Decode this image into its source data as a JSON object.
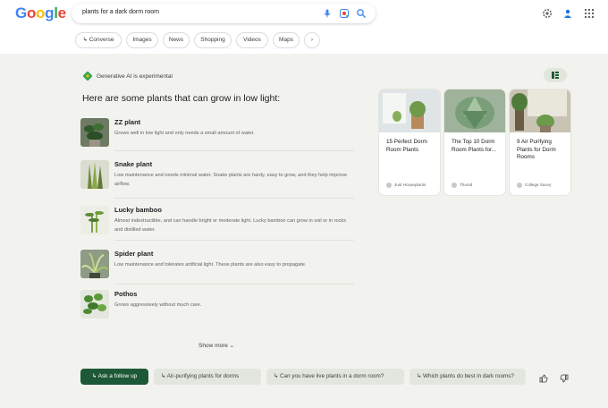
{
  "header": {
    "logo": [
      "G",
      "o",
      "o",
      "g",
      "l",
      "e"
    ],
    "query": "plants for a dark dorm room",
    "icons": [
      "microphone-icon",
      "lens-icon",
      "search-icon",
      "gear-icon",
      "account-icon",
      "apps-grid-icon"
    ]
  },
  "chips": [
    {
      "label": "↳ Converse"
    },
    {
      "label": "Images"
    },
    {
      "label": "News"
    },
    {
      "label": "Shopping"
    },
    {
      "label": "Videos"
    },
    {
      "label": "Maps"
    },
    {
      "label": "›"
    }
  ],
  "ai": {
    "label": "Generative AI is experimental",
    "heading": "Here are some plants that can grow in low light:",
    "items": [
      {
        "title": "ZZ plant",
        "desc": "Grows well in low light and only needs a small amount of water."
      },
      {
        "title": "Snake plant",
        "desc": "Low maintenance and needs minimal water. Snake plants are hardy, easy to grow, and they help improve airflow."
      },
      {
        "title": "Lucky bamboo",
        "desc": "Almost indestructible, and can handle bright or moderate light. Lucky bamboo can grow in soil or in rocks and distilled water."
      },
      {
        "title": "Spider plant",
        "desc": "Low maintenance and tolerates artificial light. These plants are also easy to propagate."
      },
      {
        "title": "Pothos",
        "desc": "Grows aggressively without much care."
      }
    ],
    "show_more": "Show more ⌄",
    "sources": [
      {
        "title": "15 Perfect Dorm Room Plants",
        "source": "Just Houseplants"
      },
      {
        "title": "The Top 10 Dorm Room Plants for...",
        "source": "Thursd"
      },
      {
        "title": "9 Air Purifying Plants for Dorm Rooms",
        "source": "College Savvy"
      }
    ]
  },
  "followup": {
    "button": "↳ Ask a follow up",
    "suggestions": [
      "↳ Air-purifying plants for dorms",
      "↳ Can you have live plants in a dorm room?",
      "↳ Which plants do best in dark rooms?"
    ]
  },
  "colors": {
    "panel_bg": "#f2f3ee",
    "accent_green": "#1e5937",
    "chip_border": "#dadce0"
  }
}
